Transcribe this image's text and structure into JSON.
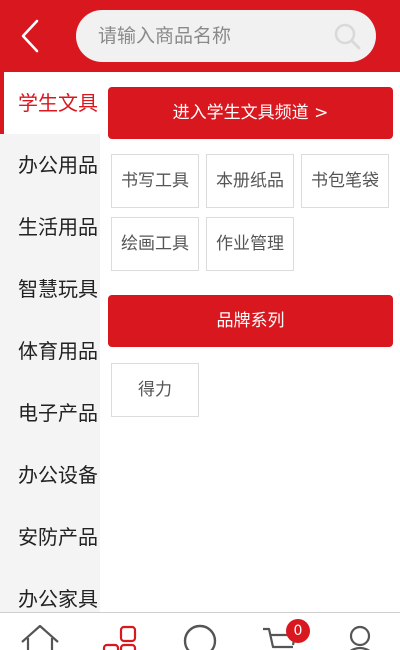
{
  "header": {
    "search_placeholder": "请输入商品名称"
  },
  "sidebar": {
    "items": [
      {
        "label": "学生文具",
        "active": true
      },
      {
        "label": "办公用品"
      },
      {
        "label": "生活用品"
      },
      {
        "label": "智慧玩具"
      },
      {
        "label": "体育用品"
      },
      {
        "label": "电子产品"
      },
      {
        "label": "办公设备"
      },
      {
        "label": "安防产品"
      },
      {
        "label": "办公家具"
      }
    ]
  },
  "content": {
    "channel_button": "进入学生文具频道 >",
    "categories": [
      "书写工具",
      "本册纸品",
      "书包笔袋",
      "绘画工具",
      "作业管理"
    ],
    "brand_header": "品牌系列",
    "brands": [
      "得力"
    ]
  },
  "bottom_nav": {
    "items": [
      {
        "icon": "home-icon"
      },
      {
        "icon": "category-icon",
        "active": true
      },
      {
        "icon": "discover-icon"
      },
      {
        "icon": "cart-icon",
        "badge": "0"
      },
      {
        "icon": "user-icon"
      }
    ]
  },
  "colors": {
    "accent": "#d8171e",
    "sidebar_bg": "#f4f4f4",
    "border": "#dcdcdc"
  }
}
